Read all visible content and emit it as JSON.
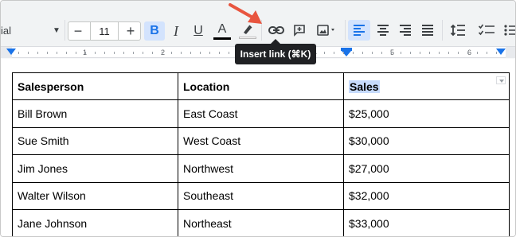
{
  "toolbar": {
    "font_name": "ial",
    "font_size": "11",
    "bold_label": "B",
    "italic_label": "I",
    "underline_label": "U",
    "text_color_label": "A",
    "size_minus": "−",
    "size_plus": "+",
    "icons": [
      "chevron-down-icon",
      "minus-icon",
      "plus-icon",
      "bold-icon",
      "italic-icon",
      "underline-icon",
      "text-color-icon",
      "highlight-icon",
      "link-icon",
      "add-comment-icon",
      "insert-image-icon",
      "align-left-icon",
      "align-center-icon",
      "align-right-icon",
      "align-justify-icon",
      "line-spacing-icon",
      "checklist-icon",
      "bulleted-list-icon"
    ]
  },
  "tooltip": {
    "text": "Insert link (⌘K)"
  },
  "ruler": {
    "labels": [
      "1",
      "2",
      "3",
      "4",
      "5",
      "6"
    ]
  },
  "colors": {
    "accent": "#1a73e8",
    "selection": "#c6dafc",
    "annotation_arrow": "#e8553f",
    "tooltip_bg": "#202124"
  },
  "table": {
    "headers": [
      "Salesperson",
      "Location",
      "Sales"
    ],
    "rows": [
      [
        "Bill Brown",
        "East Coast",
        "$25,000"
      ],
      [
        "Sue Smith",
        "West Coast",
        "$30,000"
      ],
      [
        "Jim Jones",
        "Northwest",
        "$27,000"
      ],
      [
        "Walter Wilson",
        "Southeast",
        "$32,000"
      ],
      [
        "Jane Johnson",
        "Northeast",
        "$33,000"
      ]
    ]
  }
}
